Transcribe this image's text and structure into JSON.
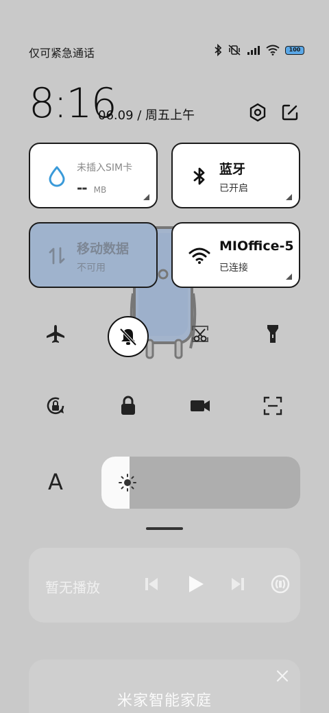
{
  "status_bar": {
    "carrier": "仅可紧急通话",
    "battery": "100",
    "icons": [
      "bluetooth-icon",
      "mute-vibrate-icon",
      "signal-icon",
      "wifi-icon",
      "battery-icon"
    ]
  },
  "header": {
    "time": "8:16",
    "date": "06.09 / 周五上午",
    "icons": [
      "settings-icon",
      "edit-icon"
    ]
  },
  "tiles": {
    "sim": {
      "title": "未插入SIM卡",
      "value": "--",
      "unit": "MB",
      "icon": "water-drop-icon"
    },
    "bluetooth": {
      "title": "蓝牙",
      "status": "已开启",
      "icon": "bluetooth-icon"
    },
    "mobile_data": {
      "title": "移动数据",
      "status": "不可用",
      "icon": "data-arrows-icon"
    },
    "wifi": {
      "title": "MIOffice-5",
      "status": "已连接",
      "icon": "wifi-icon"
    }
  },
  "toggles": [
    {
      "name": "airplane",
      "icon": "airplane-icon"
    },
    {
      "name": "mute",
      "icon": "bell-off-icon",
      "active": true
    },
    {
      "name": "screenshot",
      "icon": "scissors-icon"
    },
    {
      "name": "flashlight",
      "icon": "flashlight-icon"
    },
    {
      "name": "rotation-lock",
      "icon": "rotation-lock-icon"
    },
    {
      "name": "lock",
      "icon": "lock-icon"
    },
    {
      "name": "screen-record",
      "icon": "video-camera-icon"
    },
    {
      "name": "scanner",
      "icon": "scan-icon"
    }
  ],
  "brightness": {
    "auto_label": "A",
    "level": 0.14
  },
  "media": {
    "status": "暂无播放",
    "icons": [
      "previous-icon",
      "play-icon",
      "next-icon",
      "cast-icon"
    ]
  },
  "smart_home": {
    "title": "米家智能家庭",
    "icon": "close-icon"
  },
  "colors": {
    "background": "#c9c9c9",
    "tile": "#ffffff",
    "tile_inactive": "#9fb3cd",
    "accent_blue": "#3a9ad9"
  }
}
